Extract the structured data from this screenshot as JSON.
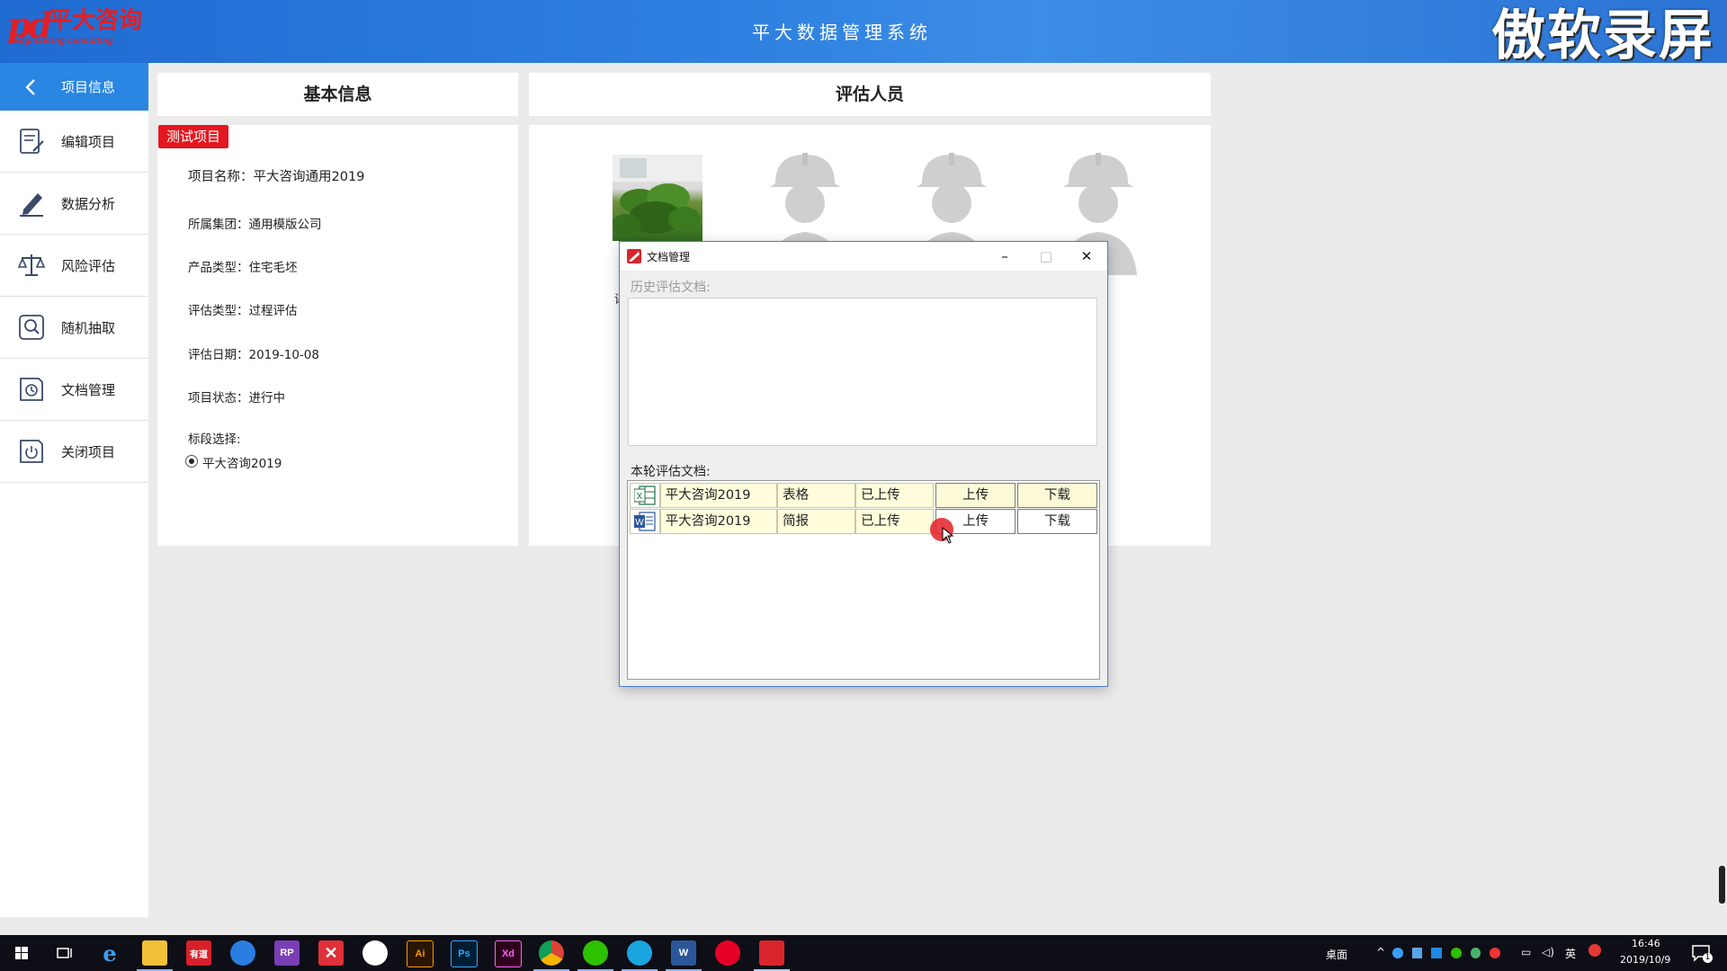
{
  "header": {
    "logo_mark": "pd",
    "logo_cn": "平大咨询",
    "logo_en": "engineering consulting",
    "app_title": "平大数据管理系统",
    "watermark": "傲软录屏"
  },
  "sidebar": {
    "items": [
      {
        "label": "项目信息",
        "icon": "back-arrow-icon",
        "active": true
      },
      {
        "label": "编辑项目",
        "icon": "edit-document-icon"
      },
      {
        "label": "数据分析",
        "icon": "pencil-icon"
      },
      {
        "label": "风险评估",
        "icon": "scale-icon"
      },
      {
        "label": "随机抽取",
        "icon": "search-icon"
      },
      {
        "label": "文档管理",
        "icon": "clock-document-icon"
      },
      {
        "label": "关闭项目",
        "icon": "power-icon"
      }
    ]
  },
  "basic_info": {
    "heading": "基本信息",
    "tag": "测试项目",
    "rows": [
      "项目名称：平大咨询通用2019",
      "所属集团：通用模版公司",
      "产品类型：住宅毛坯",
      "评估类型：过程评估",
      "评估日期：2019-10-08",
      "项目状态：进行中"
    ],
    "section_label": "标段选择:",
    "radio_option": "平大咨询2019"
  },
  "evaluators": {
    "heading": "评估人员",
    "partial_label": "评"
  },
  "dialog": {
    "title": "文档管理",
    "minimize": "–",
    "maximize": "□",
    "close": "✕",
    "history_label": "历史评估文档:",
    "current_label": "本轮评估文档:",
    "documents": [
      {
        "file_type": "excel",
        "icon_letter": "X",
        "name": "平大咨询2019",
        "type": "表格",
        "status": "已上传",
        "upload": "上传",
        "download": "下载"
      },
      {
        "file_type": "word",
        "icon_letter": "W",
        "name": "平大咨询2019",
        "type": "简报",
        "status": "已上传",
        "upload": "上传",
        "download": "下载"
      }
    ]
  },
  "taskbar": {
    "apps": [
      "windows-start-icon",
      "task-view-icon",
      "edge-icon",
      "file-explorer-icon",
      "youdao-icon",
      "qq-browser-icon",
      "axure-rp-icon",
      "xmind-icon",
      "baidu-netdisk-icon",
      "illustrator-icon",
      "photoshop-icon",
      "adobe-xd-icon",
      "chrome-icon",
      "wechat-icon",
      "contacts-icon",
      "word-icon",
      "netease-music-icon",
      "pd-app-icon"
    ],
    "labels": {
      "ai": "Ai",
      "ps": "Ps",
      "xd": "Xd",
      "rp": "RP",
      "youdao": "有道"
    },
    "desktop": "桌面",
    "ime": "英",
    "time": "16:46",
    "date": "2019/10/9",
    "notifications": "1"
  },
  "colors": {
    "header_blue": "#2d7fe0",
    "sidebar_active": "#2a86e3",
    "tag_red": "#e4161f",
    "row_yellow": "#fffddc"
  }
}
